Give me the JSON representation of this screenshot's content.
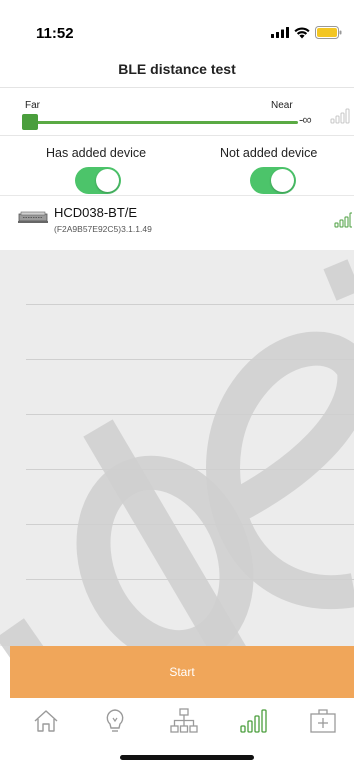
{
  "status_bar": {
    "time": "11:52"
  },
  "nav": {
    "title": "BLE distance test"
  },
  "range": {
    "far_label": "Far",
    "near_label": "Near",
    "value": "-∞"
  },
  "toggles": [
    {
      "label": "Has added device",
      "on": true
    },
    {
      "label": "Not added device",
      "on": true
    }
  ],
  "device": {
    "name": "HCD038-BT/E",
    "detail": "(F2A9B57E92C5)3.1.1.49"
  },
  "actions": {
    "start_label": "Start"
  },
  "tabs": [
    {
      "icon": "home-icon"
    },
    {
      "icon": "lightbulb-icon"
    },
    {
      "icon": "network-icon"
    },
    {
      "icon": "signal-icon"
    },
    {
      "icon": "add-box-icon"
    }
  ],
  "colors": {
    "accent_green": "#4cc46a",
    "signal_green": "#4a9e3c",
    "start_orange": "#f0a65a"
  }
}
